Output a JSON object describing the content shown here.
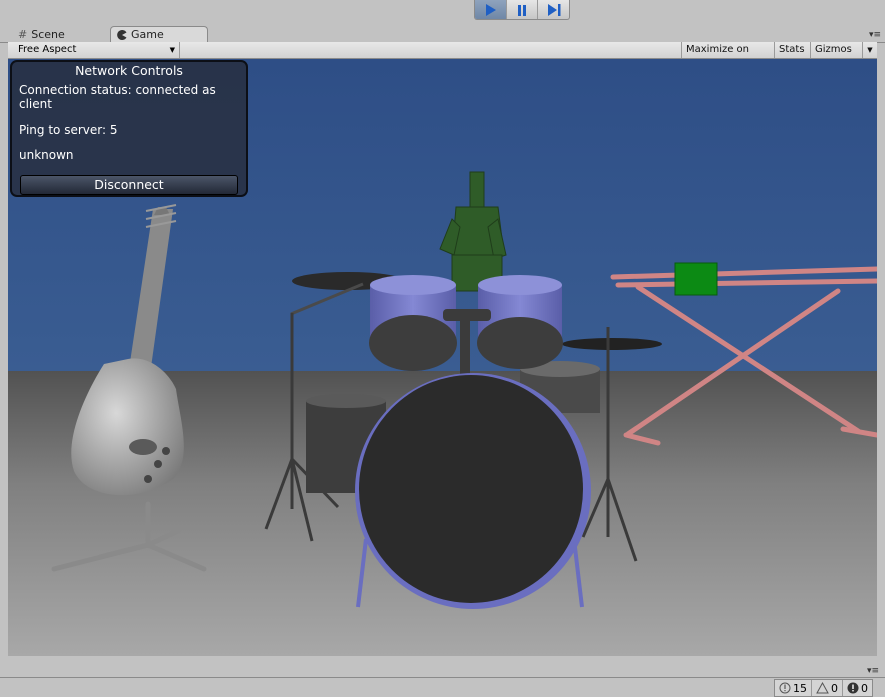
{
  "tabs": {
    "scene_label": "Scene",
    "game_label": "Game"
  },
  "game_toolbar": {
    "aspect_value": "Free Aspect",
    "maximize_label": "Maximize on Play",
    "stats_label": "Stats",
    "gizmos_label": "Gizmos"
  },
  "network_controls": {
    "title": "Network Controls",
    "status_text": "Connection status: connected as client",
    "ping_text": "Ping to server: 5",
    "info_text": "unknown",
    "disconnect_label": "Disconnect"
  },
  "console": {
    "log_count": "15",
    "warning_count": "0",
    "error_count": "0"
  },
  "colors": {
    "sky": "#33548b",
    "drum_blue": "#7b7fd0",
    "player_green": "#2d5a26",
    "keyboard_stand": "#d88a8a",
    "keyboard_green": "#0a8a12"
  },
  "icons": {
    "play": "play-icon",
    "pause": "pause-icon",
    "step": "step-icon",
    "scene": "hash-icon",
    "game": "pacman-icon"
  }
}
